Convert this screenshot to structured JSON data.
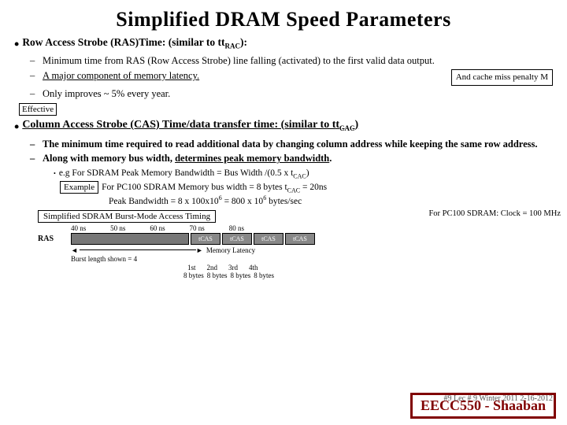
{
  "title": "Simplified DRAM Speed Parameters",
  "section1": {
    "header": "Row Access Strobe (RAS)Time: (similar to t",
    "header_sub": "RAC",
    "header_end": "):",
    "bullets": [
      "Minimum time from RAS (Row Access Strobe) line falling (activated) to the first valid data output.",
      "A major component of memory latency.",
      "Only improves ~ 5% every year."
    ],
    "bullet2_underline": true,
    "annotation": "And cache miss penalty M"
  },
  "effective_label": "Effective",
  "section2": {
    "header": "Column Access Strobe (CAS) Time/data transfer time: (similar to t",
    "header_sub": "CAC",
    "header_end": ")",
    "bullets": [
      "The minimum time required to read additional data by changing column address while keeping the same row address.",
      "Along with memory bus width, determines peak memory bandwidth."
    ],
    "bullet2_underline": "determines peak memory bandwidth"
  },
  "example": {
    "label": "Example",
    "lines": [
      "e.g For SDRAM  Peak Memory Bandwidth = Bus Width /(0.5 x t",
      "For PC100 SDRAM Memory bus width = 8 bytes   t",
      "Peak Bandwidth =  8 x 100x10",
      " = 800 x 10"
    ],
    "cac_sub1": "CAC",
    "cac_sub2": "CAC",
    "cac_val": " = 20ns",
    "exp1": "6",
    "exp2": "6",
    "suffix": " bytes/sec"
  },
  "diagram": {
    "title": "Simplified SDRAM Burst-Mode Access Timing",
    "for_pc100": "For PC100 SDRAM: Clock = 100 MHz",
    "times_ns": [
      "40 ns",
      "50 ns",
      "60 ns",
      "70 ns",
      "80 ns"
    ],
    "ras_label": "RAS",
    "cas_labels": [
      "tCAS",
      "tCAS",
      "tCAS",
      "tCAS"
    ],
    "memory_latency": "Memory Latency",
    "burst_label": "Burst length shown = 4",
    "nth_labels": [
      "1st",
      "2nd",
      "3rd",
      "4th"
    ],
    "bytes_labels": [
      "8 bytes",
      "8 bytes",
      "8 bytes",
      "8 bytes"
    ]
  },
  "eecc": "EECC550 - Shaaban",
  "page_info": "#9  Lec # 9  Winter 2011  2-16-2012"
}
